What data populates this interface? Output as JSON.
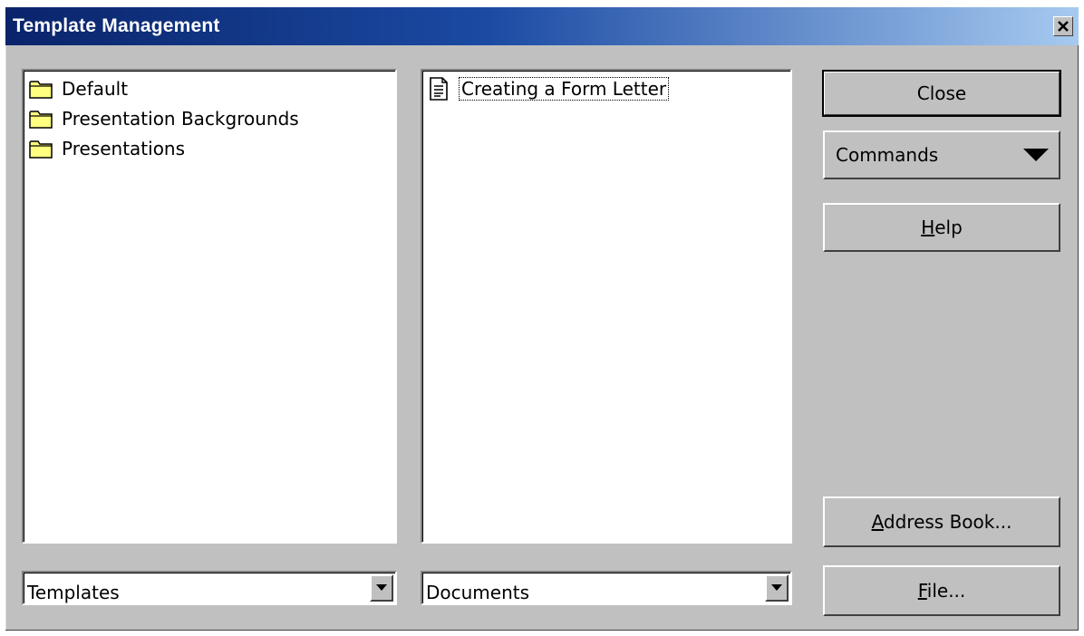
{
  "window": {
    "title": "Template Management",
    "close_icon": "close-icon"
  },
  "categories": {
    "items": [
      {
        "label": "Default",
        "icon": "folder-icon"
      },
      {
        "label": "Presentation Backgrounds",
        "icon": "folder-icon"
      },
      {
        "label": "Presentations",
        "icon": "folder-icon"
      }
    ],
    "selector_value": "Templates"
  },
  "templates": {
    "items": [
      {
        "label": "Creating a Form Letter",
        "icon": "document-icon",
        "focused": true
      }
    ],
    "selector_value": "Documents"
  },
  "buttons": {
    "close": "Close",
    "commands": "Commands",
    "help_mnemonic": "H",
    "help_rest": "elp",
    "address_book_mnemonic": "A",
    "address_book_rest": "ddress Book...",
    "file_mnemonic": "F",
    "file_rest": "ile..."
  },
  "colors": {
    "title_bar_start": "#0a246a",
    "title_bar_end": "#a6caf0",
    "dialog_face": "#c0c0c0",
    "folder_fill": "#ffff80"
  }
}
